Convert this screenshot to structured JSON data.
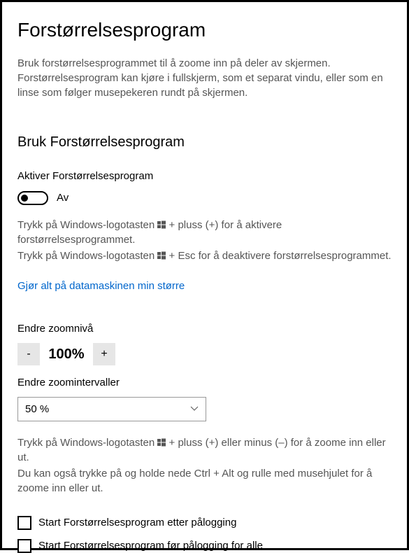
{
  "page": {
    "title": "Forstørrelsesprogram",
    "description": "Bruk forstørrelsesprogrammet til å zoome inn på deler av skjermen. Forstørrelsesprogram kan kjøre i fullskjerm, som et separat vindu, eller som en linse som følger musepekeren rundt på skjermen."
  },
  "section_use": {
    "heading": "Bruk Forstørrelsesprogram",
    "activate_label": "Aktiver Forstørrelsesprogram",
    "toggle_state": "Av",
    "help1a": "Trykk på Windows-logotasten ",
    "help1b": " + pluss (+) for å aktivere forstørrelsesprogrammet.",
    "help2a": "Trykk på Windows-logotasten ",
    "help2b": " + Esc for å deaktivere forstørrelsesprogrammet.",
    "link_text": "Gjør alt på datamaskinen min større"
  },
  "section_zoom": {
    "level_label": "Endre zoomnivå",
    "minus": "-",
    "plus": "+",
    "value": "100%",
    "interval_label": "Endre zoomintervaller",
    "interval_value": "50 %",
    "help1a": "Trykk på Windows-logotasten ",
    "help1b": " + pluss (+) eller minus (–) for å zoome inn eller ut.",
    "help2": "Du kan også trykke på og holde nede Ctrl + Alt og rulle med musehjulet for å zoome inn eller ut."
  },
  "section_start": {
    "after_login": "Start Forstørrelsesprogram etter pålogging",
    "before_login": "Start Forstørrelsesprogram før pålogging for alle"
  }
}
